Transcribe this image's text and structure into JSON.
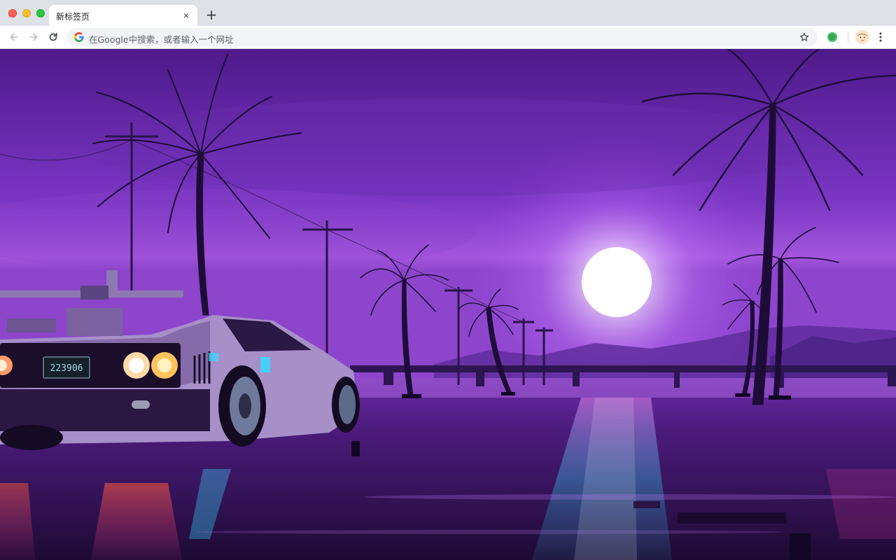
{
  "window": {
    "controls": [
      "close",
      "minimize",
      "maximize"
    ]
  },
  "tabs": [
    {
      "title": "新标签页",
      "close_icon": "×",
      "active": true
    }
  ],
  "new_tab_icon": "+",
  "toolbar": {
    "back_icon": "arrow-left-icon",
    "forward_icon": "arrow-right-icon",
    "reload_icon": "reload-icon",
    "omnibox": {
      "search_engine_icon": "google-g-icon",
      "placeholder": "在Google中搜索，或者输入一个网址"
    },
    "bookmark_icon": "star-icon",
    "extension_icon": "green-circle-extension-icon",
    "profile_icon": "avatar",
    "menu_icon": "kebab-menu-icon"
  },
  "background": {
    "description_icon": "synthwave-wallpaper",
    "license_plate": "223906",
    "colors": {
      "sky_top": "#5a1d9a",
      "sky_mid": "#7a35c2",
      "horizon": "#b063e0",
      "sun": "#ffffff",
      "road": "#2a0f45",
      "neon_cyan": "#38d9ff",
      "neon_pink": "#ff3ea5"
    }
  }
}
